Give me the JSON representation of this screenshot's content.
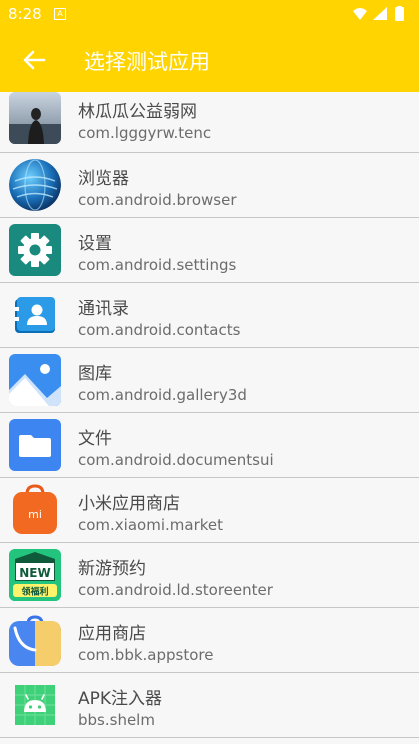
{
  "status_bar": {
    "time": "8:28"
  },
  "app_bar": {
    "title": "选择测试应用"
  },
  "apps": [
    {
      "name": "林瓜瓜公益弱网",
      "package": "com.lgggyrw.tenc",
      "icon": "photo-icon"
    },
    {
      "name": "浏览器",
      "package": "com.android.browser",
      "icon": "browser-globe-icon"
    },
    {
      "name": "设置",
      "package": "com.android.settings",
      "icon": "gear-icon"
    },
    {
      "name": "通讯录",
      "package": "com.android.contacts",
      "icon": "contacts-icon"
    },
    {
      "name": "图库",
      "package": "com.android.gallery3d",
      "icon": "gallery-icon"
    },
    {
      "name": "文件",
      "package": "com.android.documentsui",
      "icon": "folder-icon"
    },
    {
      "name": "小米应用商店",
      "package": "com.xiaomi.market",
      "icon": "mi-bag-icon",
      "icon_text": "mi"
    },
    {
      "name": "新游预约",
      "package": "com.android.ld.storeenter",
      "icon": "new-badge-icon",
      "icon_text": "NEW",
      "icon_subtext": "领福利"
    },
    {
      "name": "应用商店",
      "package": "com.bbk.appstore",
      "icon": "appstore-bag-icon"
    },
    {
      "name": "APK注入器",
      "package": "bbs.shelm",
      "icon": "android-icon"
    }
  ],
  "colors": {
    "accent": "#ffd400",
    "divider": "#c7c7c7"
  }
}
